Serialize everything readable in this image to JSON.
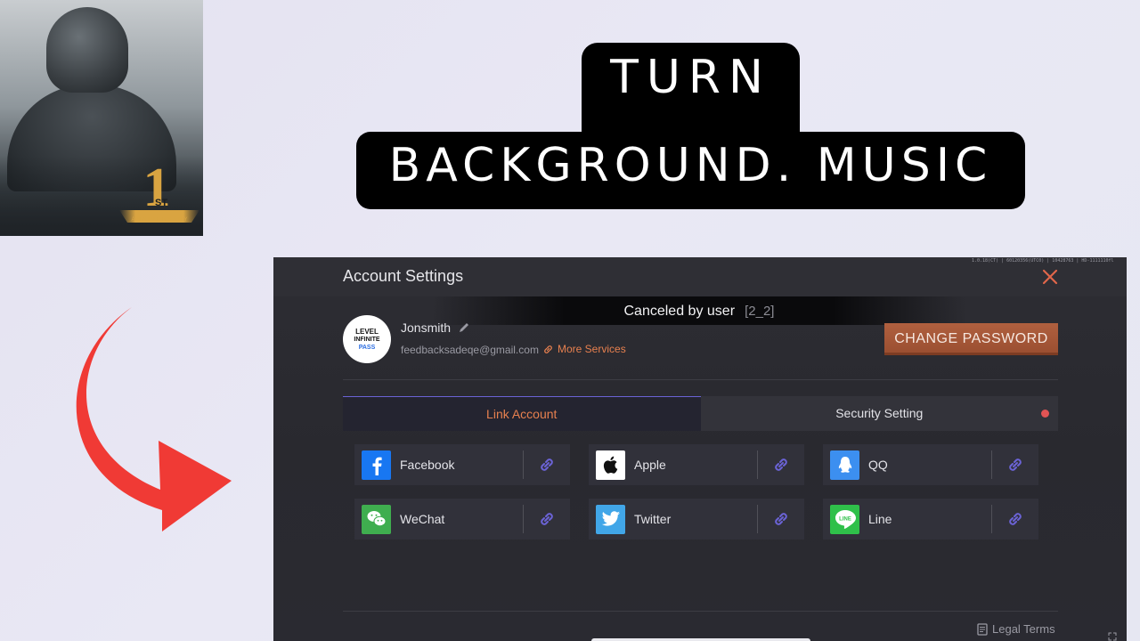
{
  "title": {
    "line1": "TURN",
    "line2": "BACKGROUND. MUSIC"
  },
  "thumbnail": {
    "badge_number": "1",
    "badge_suffix": "ST",
    "badge_text": "ANNIVERSARY"
  },
  "window": {
    "title": "Account Settings",
    "build_info": "1.0.18(CT) | 60120356(UTC0) | 10428763 | HD-1111110fl",
    "toast": {
      "text": "Canceled by user",
      "code": "[2_2]"
    },
    "profile": {
      "avatar_line1": "LEVEL",
      "avatar_line2": "INFINITE",
      "avatar_line3": "PASS",
      "username": "Jonsmith",
      "email": "feedbacksadeqe@gmail.com",
      "more_services": "More Services"
    },
    "change_password": "CHANGE PASSWORD",
    "tabs": [
      {
        "label": "Link Account"
      },
      {
        "label": "Security Setting"
      }
    ],
    "accounts": [
      {
        "name": "Facebook",
        "icon": "facebook-icon",
        "color": "#1877f2"
      },
      {
        "name": "Apple",
        "icon": "apple-icon",
        "color": "#ffffff"
      },
      {
        "name": "QQ",
        "icon": "qq-icon",
        "color": "#3c8ff0"
      },
      {
        "name": "WeChat",
        "icon": "wechat-icon",
        "color": "#3fae4f"
      },
      {
        "name": "Twitter",
        "icon": "twitter-icon",
        "color": "#41a6e8"
      },
      {
        "name": "Line",
        "icon": "line-icon",
        "color": "#2fc04a"
      }
    ],
    "legal_terms": "Legal Terms",
    "colors": {
      "accent_orange": "#e7804f",
      "button_brown": "#a55837",
      "link_purple": "#6b63d6",
      "notification_red": "#e25454"
    }
  }
}
